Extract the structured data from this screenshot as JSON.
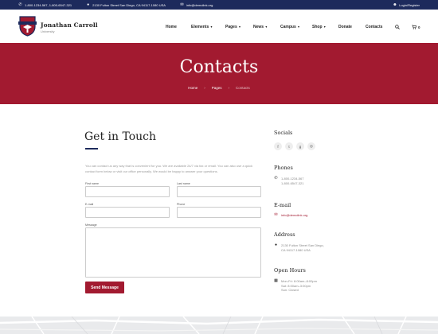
{
  "topbar": {
    "phones": "1-800-1234-567, 1-800-6547-321",
    "address": "2130 Fulton Street San Diego, CA 94117-1080 USA",
    "email": "info@demolink.org",
    "login": "Login/Register",
    "icons": [
      "phone-icon",
      "location-icon",
      "mail-icon",
      "user-icon"
    ]
  },
  "header": {
    "brand_name": "Jonathan Carroll",
    "brand_sub": "University",
    "nav": [
      {
        "label": "Home",
        "dropdown": false
      },
      {
        "label": "Elements",
        "dropdown": true
      },
      {
        "label": "Pages",
        "dropdown": true
      },
      {
        "label": "News",
        "dropdown": true
      },
      {
        "label": "Campus",
        "dropdown": true
      },
      {
        "label": "Shop",
        "dropdown": true
      },
      {
        "label": "Donate",
        "dropdown": false
      },
      {
        "label": "Contacts",
        "dropdown": false
      }
    ],
    "search_icon": "search-icon",
    "cart_icon": "cart-icon",
    "cart_count": "0"
  },
  "hero": {
    "title": "Contacts",
    "breadcrumbs": [
      "Home",
      "Pages",
      "Contacts"
    ],
    "background_color": "#a21a30"
  },
  "form": {
    "heading": "Get in Touch",
    "intro": "You can contact us any way that is convenient for you. We are available 24/7 via fax or email. You can also use a quick contact form below or visit our office personally. We would be happy to answer your questions.",
    "first_name_label": "First name",
    "last_name_label": "Last name",
    "email_label": "E-mail",
    "phone_label": "Phone",
    "message_label": "Message",
    "first_name_value": "",
    "last_name_value": "",
    "email_value": "",
    "phone_value": "",
    "message_value": "",
    "submit_label": "Send Message"
  },
  "sidebar": {
    "socials_heading": "Socials",
    "socials": [
      {
        "icon": "facebook-icon",
        "glyph": "f"
      },
      {
        "icon": "twitter-icon",
        "glyph": "t"
      },
      {
        "icon": "google-plus-icon",
        "glyph": "g"
      },
      {
        "icon": "instagram-icon",
        "glyph": "◎"
      }
    ],
    "phones_heading": "Phones",
    "phones": [
      "1-800-1234-567",
      "1-800-6547-321"
    ],
    "email_heading": "E-mail",
    "email": "info@demolink.org",
    "address_heading": "Address",
    "address_line1": "2130 Fulton Street San Diego,",
    "address_line2": "CA 94117-1080 USA",
    "hours_heading": "Open Hours",
    "hours": [
      "Mon-Fri: 8:00am–8:00pm",
      "Sat: 8:00am–3:00pm",
      "Sun: Closed"
    ]
  },
  "colors": {
    "navy": "#1d2a5c",
    "crimson": "#a21a30"
  }
}
